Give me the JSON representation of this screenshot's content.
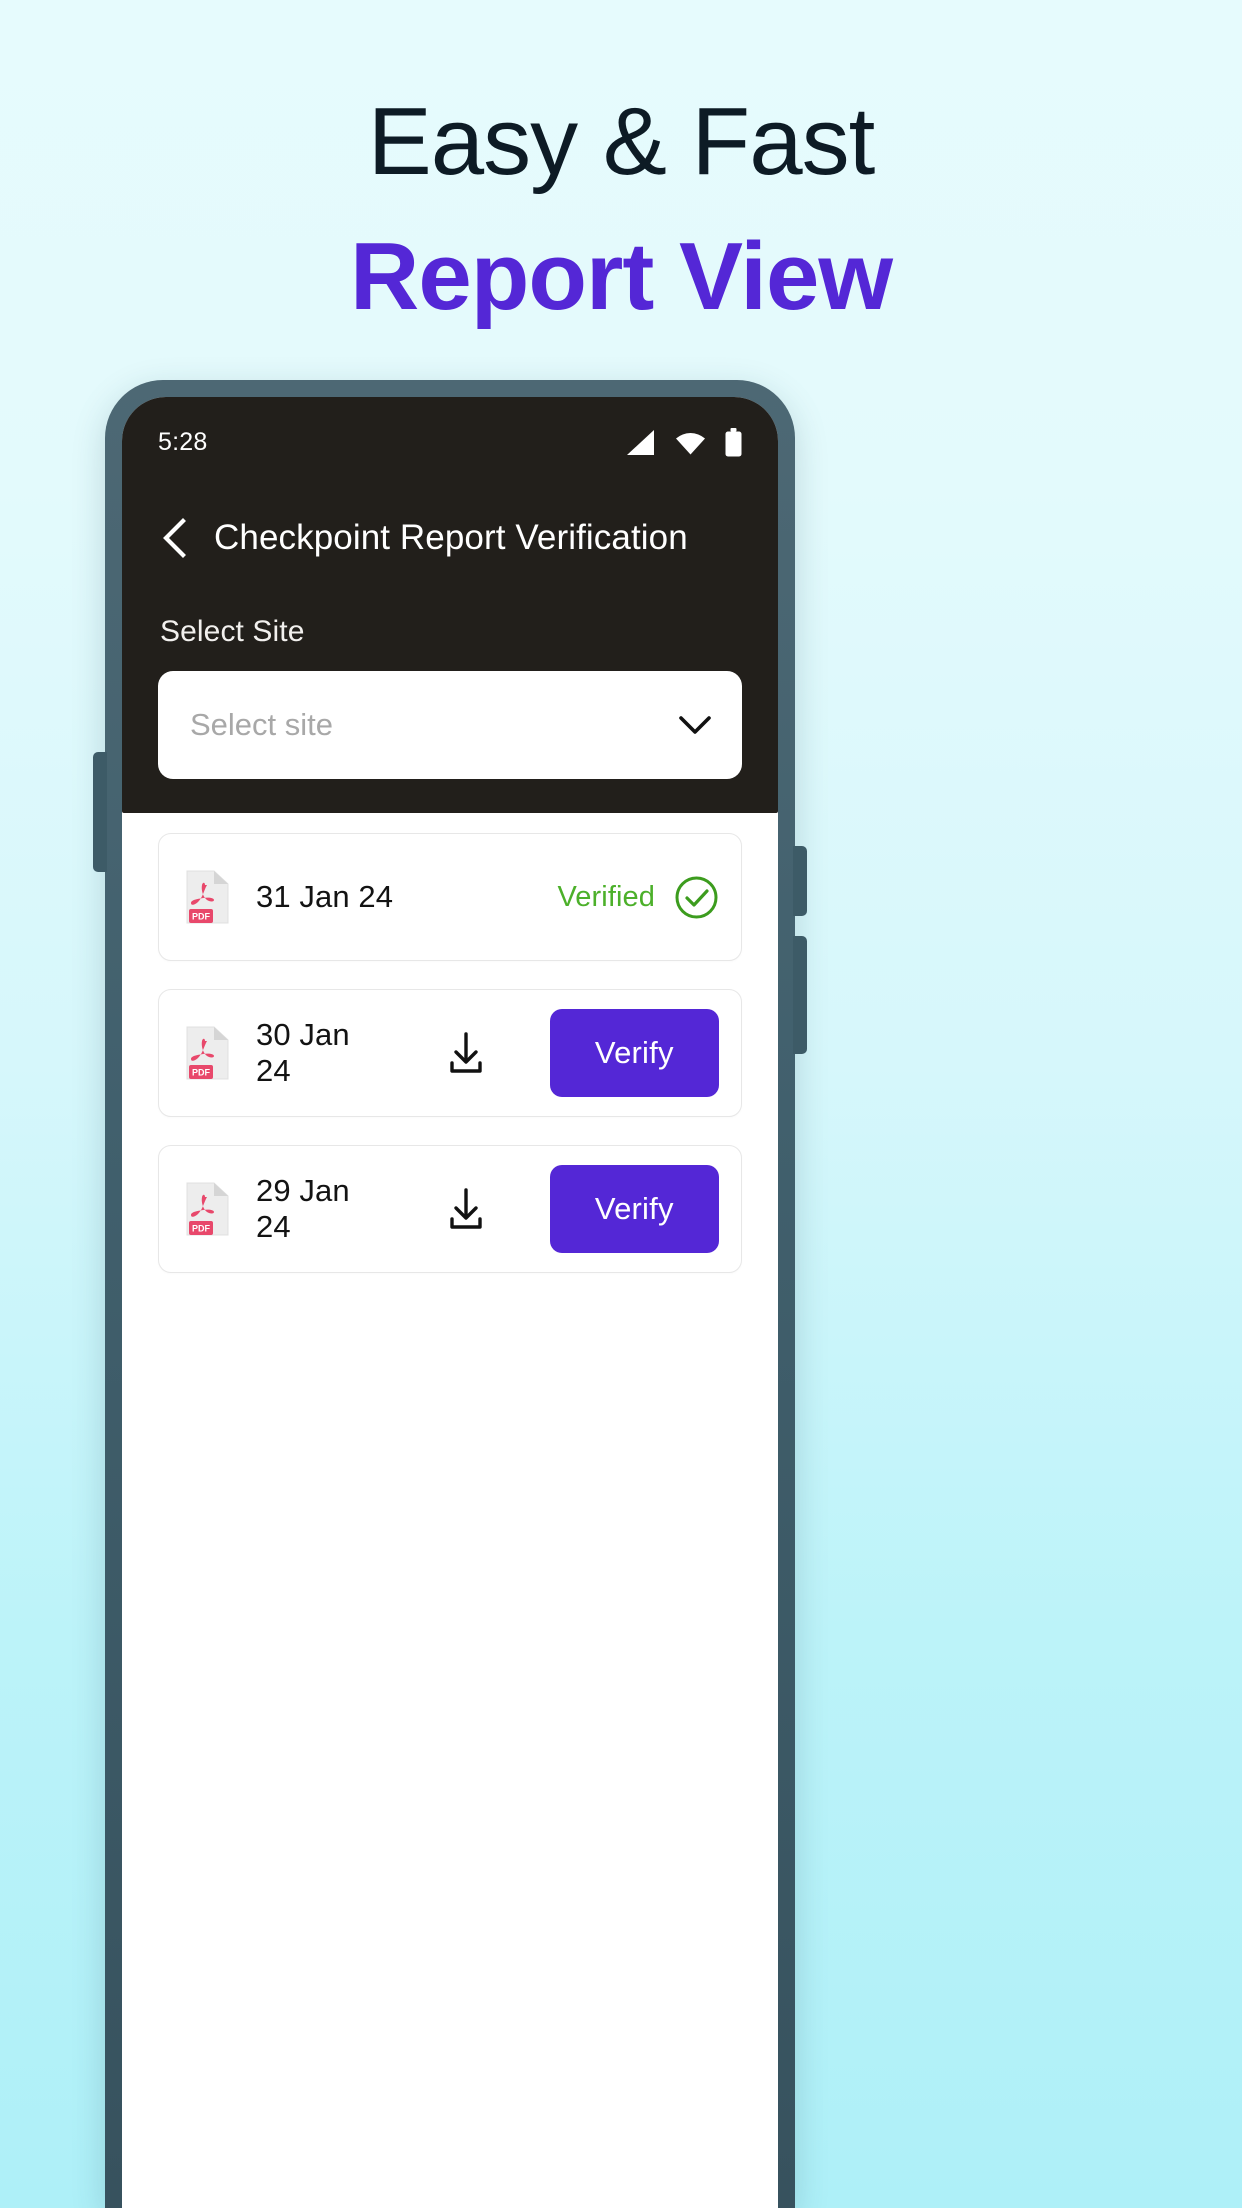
{
  "promo": {
    "line1": "Easy & Fast",
    "line2": "Report View",
    "line1_color": "#0d1b25",
    "line2_color": "#5427d6"
  },
  "phone": {
    "status_bar": {
      "time": "5:28",
      "icons": [
        "signal-icon",
        "wifi-icon",
        "battery-icon"
      ]
    },
    "appbar": {
      "back_icon": "chevron-left-icon",
      "title": "Checkpoint Report Verification"
    },
    "form": {
      "select_site_label": "Select Site",
      "select_site_placeholder": "Select site",
      "select_site_value": "",
      "dropdown_icon": "chevron-down-icon"
    },
    "reports": [
      {
        "file_icon": "pdf-file-icon",
        "date": "31 Jan 24",
        "status_label": "Verified",
        "status_color": "#4cb02a",
        "has_check_icon": true,
        "has_download_icon": false,
        "action_label": ""
      },
      {
        "file_icon": "pdf-file-icon",
        "date": "30 Jan 24",
        "status_label": "",
        "status_color": "",
        "has_check_icon": false,
        "has_download_icon": true,
        "action_label": "Verify"
      },
      {
        "file_icon": "pdf-file-icon",
        "date": "29 Jan 24",
        "status_label": "",
        "status_color": "",
        "has_check_icon": false,
        "has_download_icon": true,
        "action_label": "Verify"
      }
    ],
    "theme": {
      "accent": "#5427d6",
      "header_bg": "#221f1b",
      "verified_green": "#4cb02a",
      "pdf_red": "#e8486b",
      "frame": "#41606d"
    }
  }
}
